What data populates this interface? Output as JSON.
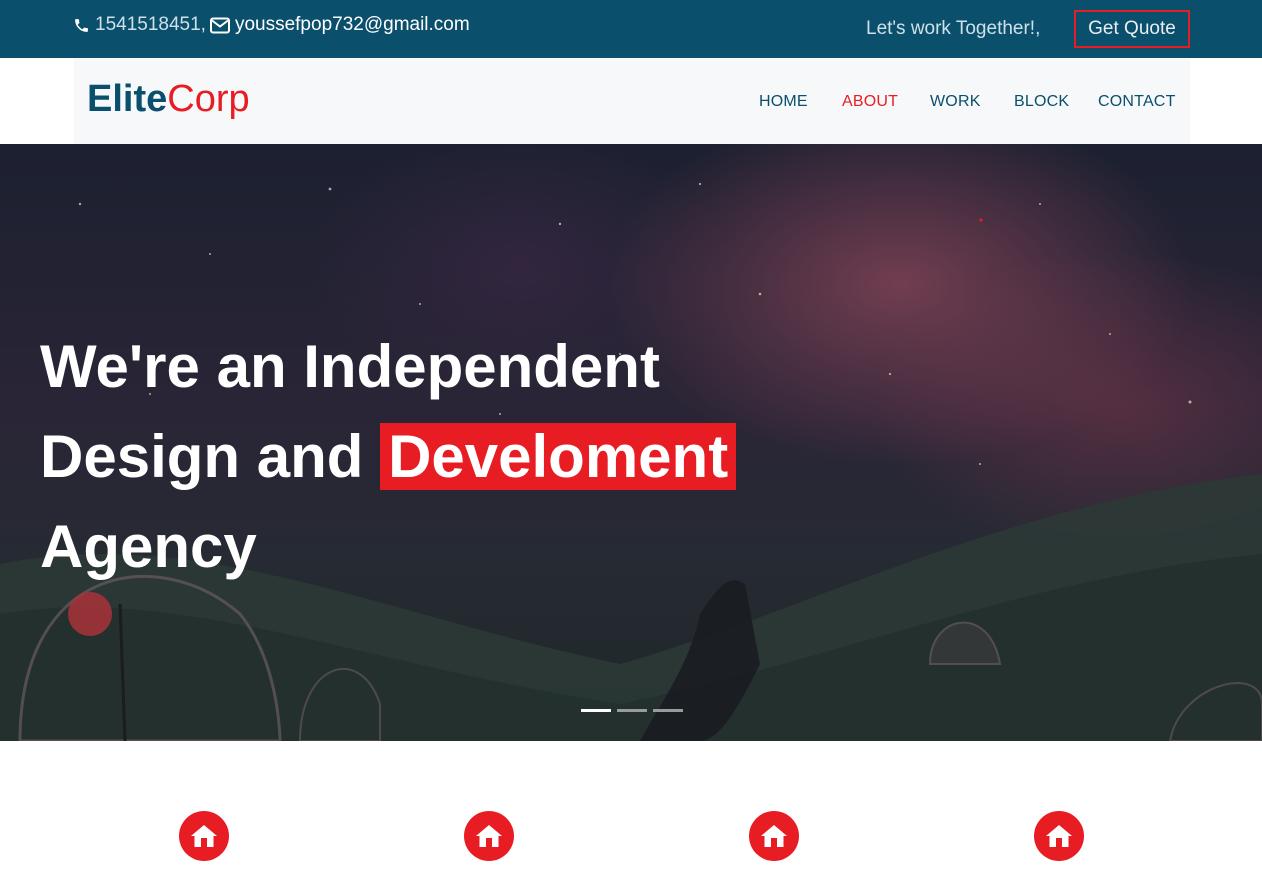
{
  "topbar": {
    "phone": "1541518451,",
    "email": "youssefpop732@gmail.com",
    "tagline": "Let's work Together!,",
    "quote_button": "Get Quote"
  },
  "logo": {
    "part1": "Elite",
    "part2": "Corp"
  },
  "nav": {
    "items": [
      "HOME",
      "ABOUT",
      "WORK",
      "BLOCK",
      "CONTACT"
    ],
    "active": "ABOUT"
  },
  "hero": {
    "line1": "We're an Independent",
    "line2_prefix": "Design and ",
    "line2_highlight": "Develoment",
    "line3": "Agency",
    "slides": 3,
    "active_slide": 1
  },
  "features": {
    "icons": [
      "home-icon",
      "home-icon",
      "home-icon",
      "home-icon"
    ]
  },
  "colors": {
    "brand_dark": "#0a4f6b",
    "accent": "#e81d24",
    "nav_bg": "#f6f8fa"
  }
}
